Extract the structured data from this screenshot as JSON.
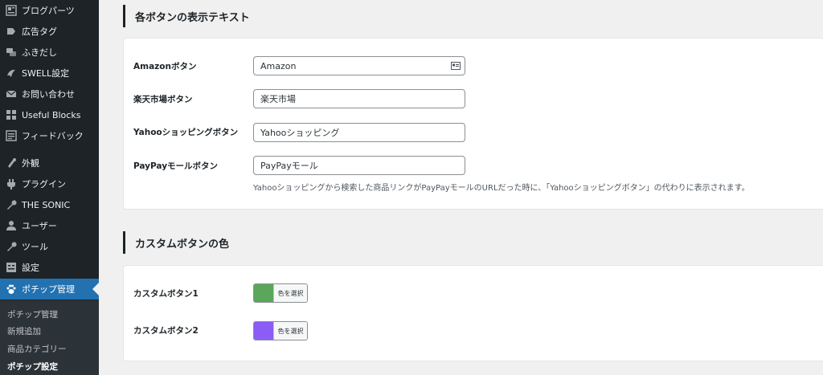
{
  "sidebar": {
    "items": [
      {
        "label": "ブログパーツ",
        "icon": "blog-parts-icon"
      },
      {
        "label": "広告タグ",
        "icon": "ad-tag-icon"
      },
      {
        "label": "ふきだし",
        "icon": "speech-bubble-icon"
      },
      {
        "label": "SWELL設定",
        "icon": "swell-icon"
      },
      {
        "label": "お問い合わせ",
        "icon": "mail-icon"
      },
      {
        "label": "Useful Blocks",
        "icon": "blocks-icon"
      },
      {
        "label": "フィードバック",
        "icon": "feedback-icon"
      },
      {
        "label": "外観",
        "icon": "appearance-icon"
      },
      {
        "label": "プラグイン",
        "icon": "plugin-icon"
      },
      {
        "label": "THE SONIC",
        "icon": "wrench-icon"
      },
      {
        "label": "ユーザー",
        "icon": "user-icon"
      },
      {
        "label": "ツール",
        "icon": "tools-icon"
      },
      {
        "label": "設定",
        "icon": "settings-icon"
      },
      {
        "label": "ポチップ管理",
        "icon": "paw-icon"
      }
    ],
    "submenu": [
      {
        "label": "ポチップ管理"
      },
      {
        "label": "新規追加"
      },
      {
        "label": "商品カテゴリー"
      },
      {
        "label": "ポチップ設定"
      }
    ]
  },
  "section1": {
    "title": "各ボタンの表示テキスト",
    "fields": [
      {
        "label": "Amazonボタン",
        "value": "Amazon"
      },
      {
        "label": "楽天市場ボタン",
        "value": "楽天市場"
      },
      {
        "label": "Yahooショッピングボタン",
        "value": "Yahooショッピング"
      },
      {
        "label": "PayPayモールボタン",
        "value": "PayPayモール"
      }
    ],
    "description": "Yahooショッピングから検索した商品リンクがPayPayモールのURLだった時に、「Yahooショッピングボタン」の代わりに表示されます。"
  },
  "section2": {
    "title": "カスタムボタンの色",
    "fields": [
      {
        "label": "カスタムボタン1",
        "color": "#5aa65a",
        "button_label": "色を選択"
      },
      {
        "label": "カスタムボタン2",
        "color": "#8b5cf6",
        "button_label": "色を選択"
      }
    ]
  },
  "colors": {
    "sidebar_bg": "#1d2327",
    "active_bg": "#2271b1"
  }
}
